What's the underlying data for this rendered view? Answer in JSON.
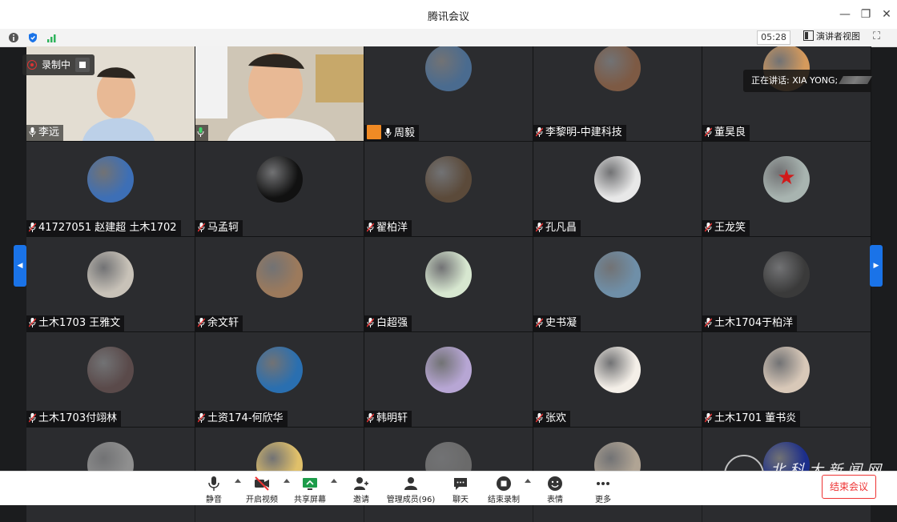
{
  "window": {
    "title": "腾讯会议"
  },
  "toolbar": {
    "timer": "05:28",
    "speaker_view_label": "演讲者视图"
  },
  "recording": {
    "label": "录制中"
  },
  "speaking": {
    "label": "正在讲话: XIA YONG;"
  },
  "participants": [
    {
      "name": "李远",
      "muted": false,
      "video": true
    },
    {
      "name": "",
      "muted": false,
      "video": true
    },
    {
      "name": "周毅",
      "muted": false,
      "video": false
    },
    {
      "name": "李黎明-中建科技",
      "muted": true,
      "video": false
    },
    {
      "name": "董昊良",
      "muted": true,
      "video": false
    },
    {
      "name": "41727051 赵建超 土木1702",
      "muted": true,
      "video": false
    },
    {
      "name": "马孟轲",
      "muted": true,
      "video": false
    },
    {
      "name": "翟柏洋",
      "muted": true,
      "video": false
    },
    {
      "name": "孔凡昌",
      "muted": true,
      "video": false
    },
    {
      "name": "王龙笑",
      "muted": true,
      "video": false
    },
    {
      "name": "土木1703 王雅文",
      "muted": true,
      "video": false
    },
    {
      "name": "余文轩",
      "muted": true,
      "video": false
    },
    {
      "name": "白超强",
      "muted": true,
      "video": false
    },
    {
      "name": "史书凝",
      "muted": true,
      "video": false
    },
    {
      "name": "土木1704于柏洋",
      "muted": true,
      "video": false
    },
    {
      "name": "土木1703付翊林",
      "muted": true,
      "video": false
    },
    {
      "name": "土资174-何欣华",
      "muted": true,
      "video": false
    },
    {
      "name": "韩明轩",
      "muted": true,
      "video": false
    },
    {
      "name": "张欢",
      "muted": true,
      "video": false
    },
    {
      "name": "土木1701 董书炎",
      "muted": true,
      "video": false
    },
    {
      "name": "",
      "muted": true,
      "video": false
    },
    {
      "name": "",
      "muted": true,
      "video": false
    },
    {
      "name": "",
      "muted": true,
      "video": false
    },
    {
      "name": "",
      "muted": true,
      "video": false
    },
    {
      "name": "",
      "muted": true,
      "video": false
    }
  ],
  "controls": {
    "mute": "静音",
    "video": "开启视频",
    "share": "共享屏幕",
    "invite": "邀请",
    "members": "管理成员(96)",
    "chat": "聊天",
    "stop_record": "结束录制",
    "reactions": "表情",
    "more": "更多",
    "end_meeting": "结束会议"
  },
  "watermark": {
    "text": "北科大新闻网"
  },
  "colors": {
    "accent": "#1a73e8",
    "danger": "#e03333",
    "tile_bg": "#2b2c2f"
  }
}
